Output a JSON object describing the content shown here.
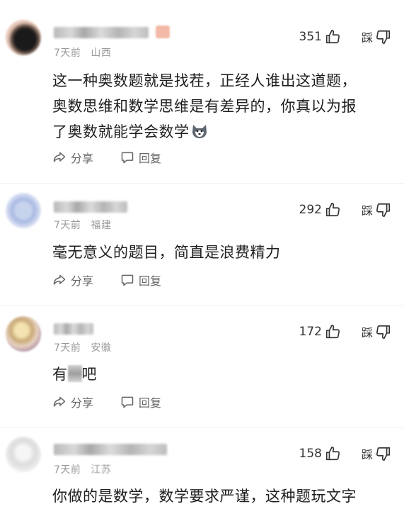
{
  "comments": [
    {
      "time": "7天前",
      "location": "山西",
      "likes": "351",
      "dislike_label": "踩",
      "text_lines": [
        "这一种奥数题就是找茬，正经人谁出这道题，",
        "奥数思维和数学思维是有差异的，你真以为报",
        "了奥数就能学会数学"
      ],
      "share_label": "分享",
      "reply_label": "回复"
    },
    {
      "time": "7天前",
      "location": "福建",
      "likes": "292",
      "dislike_label": "踩",
      "text_lines": [
        "毫无意义的题目，简直是浪费精力"
      ],
      "share_label": "分享",
      "reply_label": "回复"
    },
    {
      "time": "7天前",
      "location": "安徽",
      "likes": "172",
      "dislike_label": "踩",
      "text_prefix": "有",
      "text_suffix": "吧",
      "share_label": "分享",
      "reply_label": "回复"
    },
    {
      "time": "7天前",
      "location": "江苏",
      "likes": "158",
      "dislike_label": "踩",
      "text_lines": [
        "你做的是数学，数学要求严谨，这种题玩文字"
      ]
    }
  ],
  "icons": {
    "like": "thumbs-up-icon",
    "dislike": "thumbs-down-icon",
    "share": "share-icon",
    "reply": "comment-icon",
    "emoji": "dog-emoji-icon"
  }
}
